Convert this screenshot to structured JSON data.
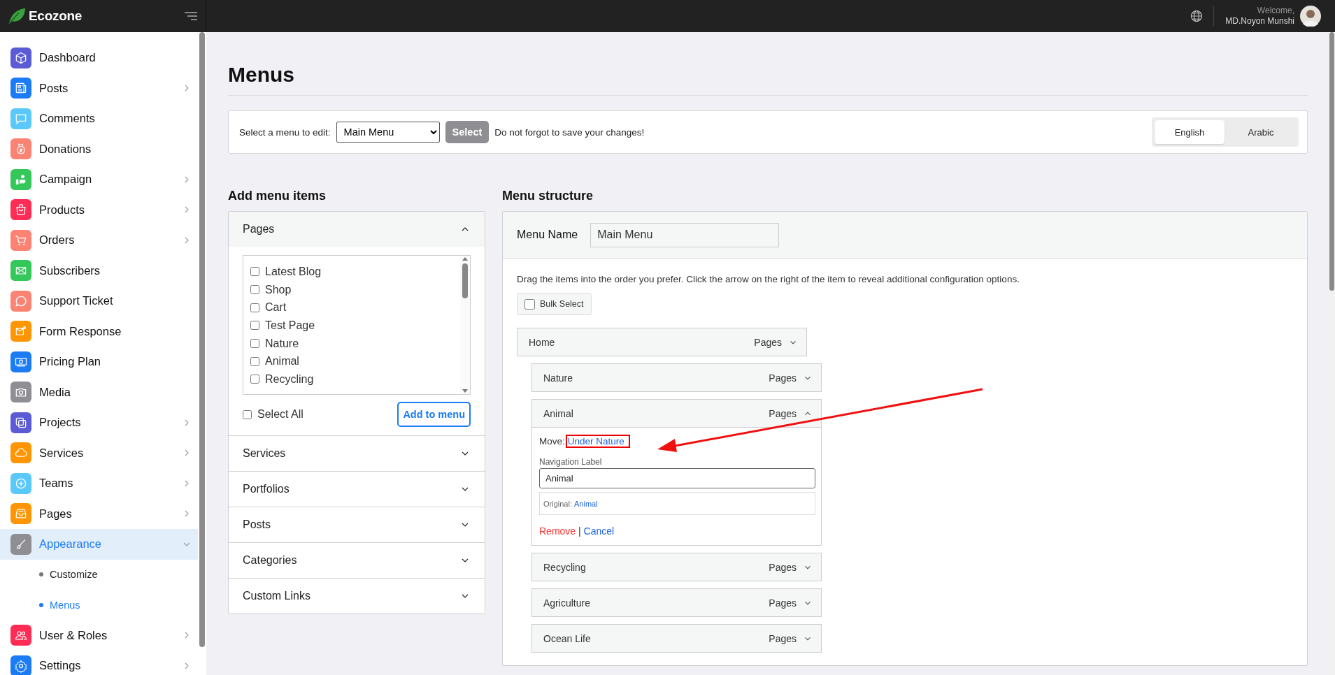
{
  "topbar": {
    "brand": "Ecozone",
    "welcome": "Welcome,",
    "user_name": "MD.Noyon Munshi"
  },
  "sidebar": {
    "items": [
      {
        "label": "Dashboard",
        "color": "#5b5bd6",
        "has_submenu": false,
        "selected": false
      },
      {
        "label": "Posts",
        "color": "#1b7cf5",
        "has_submenu": true,
        "expanded": false,
        "selected": false
      },
      {
        "label": "Comments",
        "color": "#5ac8fa",
        "has_submenu": false,
        "selected": false
      },
      {
        "label": "Donations",
        "color": "#fb8374",
        "has_submenu": false,
        "selected": false
      },
      {
        "label": "Campaign",
        "color": "#34c759",
        "has_submenu": true,
        "expanded": false,
        "selected": false
      },
      {
        "label": "Products",
        "color": "#ff2d55",
        "has_submenu": true,
        "expanded": false,
        "selected": false
      },
      {
        "label": "Orders",
        "color": "#fb8374",
        "has_submenu": true,
        "expanded": false,
        "selected": false
      },
      {
        "label": "Subscribers",
        "color": "#34c759",
        "has_submenu": false,
        "selected": false
      },
      {
        "label": "Support Ticket",
        "color": "#fb8374",
        "has_submenu": false,
        "selected": false
      },
      {
        "label": "Form Response",
        "color": "#ff9500",
        "has_submenu": false,
        "selected": false
      },
      {
        "label": "Pricing Plan",
        "color": "#1b7cf5",
        "has_submenu": false,
        "selected": false
      },
      {
        "label": "Media",
        "color": "#8e8e93",
        "has_submenu": false,
        "selected": false
      },
      {
        "label": "Projects",
        "color": "#5b5bd6",
        "has_submenu": true,
        "expanded": false,
        "selected": false
      },
      {
        "label": "Services",
        "color": "#ff9500",
        "has_submenu": true,
        "expanded": false,
        "selected": false
      },
      {
        "label": "Teams",
        "color": "#5ac8fa",
        "has_submenu": true,
        "expanded": false,
        "selected": false
      },
      {
        "label": "Pages",
        "color": "#ff9500",
        "has_submenu": true,
        "expanded": false,
        "selected": false
      },
      {
        "label": "Appearance",
        "color": "#8e8e93",
        "has_submenu": true,
        "expanded": true,
        "selected": true,
        "children": [
          {
            "label": "Customize",
            "selected": false
          },
          {
            "label": "Menus",
            "selected": true
          }
        ]
      },
      {
        "label": "User & Roles",
        "color": "#ff2d55",
        "has_submenu": true,
        "expanded": false,
        "selected": false
      },
      {
        "label": "Settings",
        "color": "#1b7cf5",
        "has_submenu": true,
        "expanded": false,
        "selected": false
      }
    ]
  },
  "page": {
    "title": "Menus"
  },
  "menu_select": {
    "label": "Select a menu to edit:",
    "value": "Main Menu",
    "button": "Select",
    "note": "Do not forgot to save your changes!",
    "languages": [
      {
        "label": "English",
        "selected": true
      },
      {
        "label": "Arabic",
        "selected": false
      }
    ]
  },
  "add_menu_items": {
    "heading": "Add menu items",
    "sections": [
      {
        "title": "Pages",
        "expanded": true,
        "items": [
          {
            "label": "Latest Blog",
            "checked": false
          },
          {
            "label": "Shop",
            "checked": false
          },
          {
            "label": "Cart",
            "checked": false
          },
          {
            "label": "Test Page",
            "checked": false
          },
          {
            "label": "Nature",
            "checked": false
          },
          {
            "label": "Animal",
            "checked": false
          },
          {
            "label": "Recycling",
            "checked": false
          }
        ],
        "select_all": {
          "label": "Select All",
          "checked": false
        },
        "add_button": "Add to menu"
      },
      {
        "title": "Services",
        "expanded": false
      },
      {
        "title": "Portfolios",
        "expanded": false
      },
      {
        "title": "Posts",
        "expanded": false
      },
      {
        "title": "Categories",
        "expanded": false
      },
      {
        "title": "Custom Links",
        "expanded": false
      }
    ]
  },
  "menu_structure": {
    "heading": "Menu structure",
    "name_label": "Menu Name",
    "name_value": "Main Menu",
    "instructions": "Drag the items into the order you prefer. Click the arrow on the right of the item to reveal additional configuration options.",
    "bulk_select": {
      "label": "Bulk Select",
      "checked": false
    },
    "items": [
      {
        "label": "Home",
        "type": "Pages",
        "expanded": false,
        "children": [
          {
            "label": "Nature",
            "type": "Pages",
            "expanded": false
          },
          {
            "label": "Animal",
            "type": "Pages",
            "expanded": true,
            "move_label": "Move:",
            "move_link": "Under Nature",
            "nav_label": "Navigation Label",
            "nav_value": "Animal",
            "original_label": "Original:",
            "original_link": "Animal",
            "remove": "Remove",
            "separator": "|",
            "cancel": "Cancel"
          },
          {
            "label": "Recycling",
            "type": "Pages",
            "expanded": false
          },
          {
            "label": "Agriculture",
            "type": "Pages",
            "expanded": false
          },
          {
            "label": "Ocean Life",
            "type": "Pages",
            "expanded": false
          }
        ]
      }
    ]
  }
}
